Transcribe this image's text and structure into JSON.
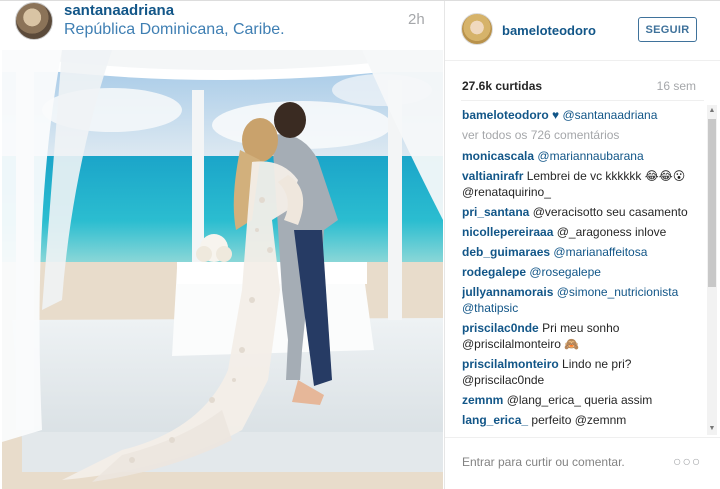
{
  "post": {
    "username": "santanaadriana",
    "location": "República Dominicana, Caribe.",
    "time": "2h"
  },
  "sidebar": {
    "username": "bameloteodoro",
    "follow_label": "SEGUIR",
    "likes": "27.6k curtidas",
    "age": "16 sem",
    "caption": {
      "user": "bameloteodoro",
      "text": "♥ @santanaadriana"
    },
    "view_all": "ver todos os 726 comentários",
    "comments": [
      {
        "user": "monicascala",
        "text": "@mariannaubarana"
      },
      {
        "user": "valtianirafr",
        "text": "Lembrei de vc kkkkkk 😂😂😮 @renataquirino_"
      },
      {
        "user": "pri_santana",
        "text": "@veracisotto seu casamento"
      },
      {
        "user": "nicollepereiraaa",
        "text": "@_aragoness inlove"
      },
      {
        "user": "deb_guimaraes",
        "text": "@marianaffeitosa"
      },
      {
        "user": "rodegalepe",
        "text": "@rosegalepe"
      },
      {
        "user": "jullyannamorais",
        "text": "@simone_nutricionista @thatipsic"
      },
      {
        "user": "priscilac0nde",
        "text": "Pri meu sonho @priscilalmonteiro 🙈"
      },
      {
        "user": "priscilalmonteiro",
        "text": "Lindo ne pri? @priscilac0nde"
      },
      {
        "user": "zemnm",
        "text": "@lang_erica_ queria assim"
      },
      {
        "user": "lang_erica_",
        "text": "perfeito @zemnm"
      }
    ],
    "add_comment_placeholder": "Entrar para curtir ou comentar.",
    "more_label": "○○○"
  },
  "colors": {
    "link": "#125688",
    "follow": "#3f729b",
    "muted": "#a5a7aa"
  },
  "icons": {
    "scroll_up": "scroll-up-arrow-icon",
    "scroll_down": "scroll-down-arrow-icon",
    "more": "more-options-icon"
  }
}
